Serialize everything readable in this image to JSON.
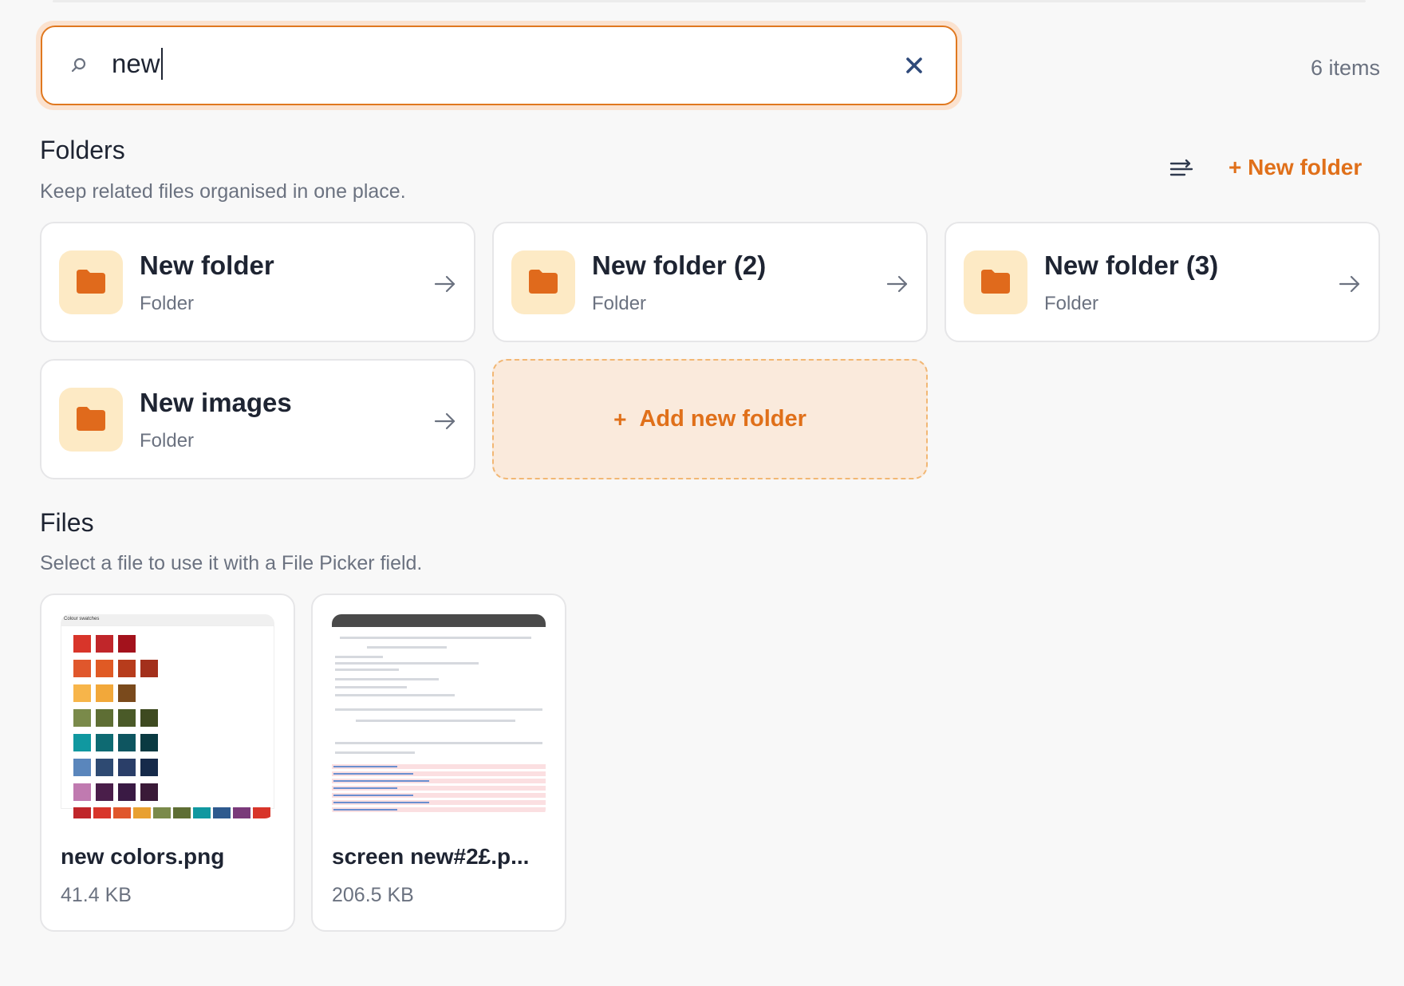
{
  "search": {
    "value": "new",
    "items_count": "6 items"
  },
  "folders": {
    "title": "Folders",
    "subtitle": "Keep related files organised in one place.",
    "new_folder_label": "+ New folder",
    "items": [
      {
        "name": "New folder",
        "type": "Folder"
      },
      {
        "name": "New folder (2)",
        "type": "Folder"
      },
      {
        "name": "New folder (3)",
        "type": "Folder"
      },
      {
        "name": "New images",
        "type": "Folder"
      }
    ],
    "add_plus": "+",
    "add_label": "Add new folder"
  },
  "files": {
    "title": "Files",
    "subtitle": "Select a file to use it with a File Picker field.",
    "items": [
      {
        "name": "new colors.png",
        "size": "41.4 KB",
        "thumb_caption": "Colour swatches"
      },
      {
        "name": "screen new#2£.p...",
        "size": "206.5 KB"
      }
    ]
  },
  "colors": {
    "accent": "#e0701a",
    "focus_border": "#e0781f",
    "folder_icon": "#e06a1c",
    "folder_tile": "#fdeac5",
    "clear_icon": "#2f4a7a"
  },
  "swatches": [
    [
      "#d8352a",
      "#c0262a",
      "#a3121c"
    ],
    [
      "#e0572c",
      "#e05a24",
      "#b73c1c",
      "#a3301c"
    ],
    [
      "#f7b54a",
      "#f2a83a",
      "#7a4a1c"
    ],
    [
      "#7a8a4a",
      "#5e6e34",
      "#4a5a28",
      "#3e4a20"
    ],
    [
      "#1098a0",
      "#0e6a72",
      "#0e5560",
      "#0a3a42"
    ],
    [
      "#5a86bc",
      "#2e4a72",
      "#2a3e68",
      "#162a4a"
    ],
    [
      "#c07ab0",
      "#4a1e4a",
      "#3a1a44",
      "#3a1a38"
    ]
  ],
  "swatch_strip": [
    "#c0262a",
    "#d8352a",
    "#e0572c",
    "#e8a030",
    "#7a8a4a",
    "#5e6e34",
    "#1098a0",
    "#2e5a8e",
    "#7a3a7a",
    "#d8352a"
  ]
}
